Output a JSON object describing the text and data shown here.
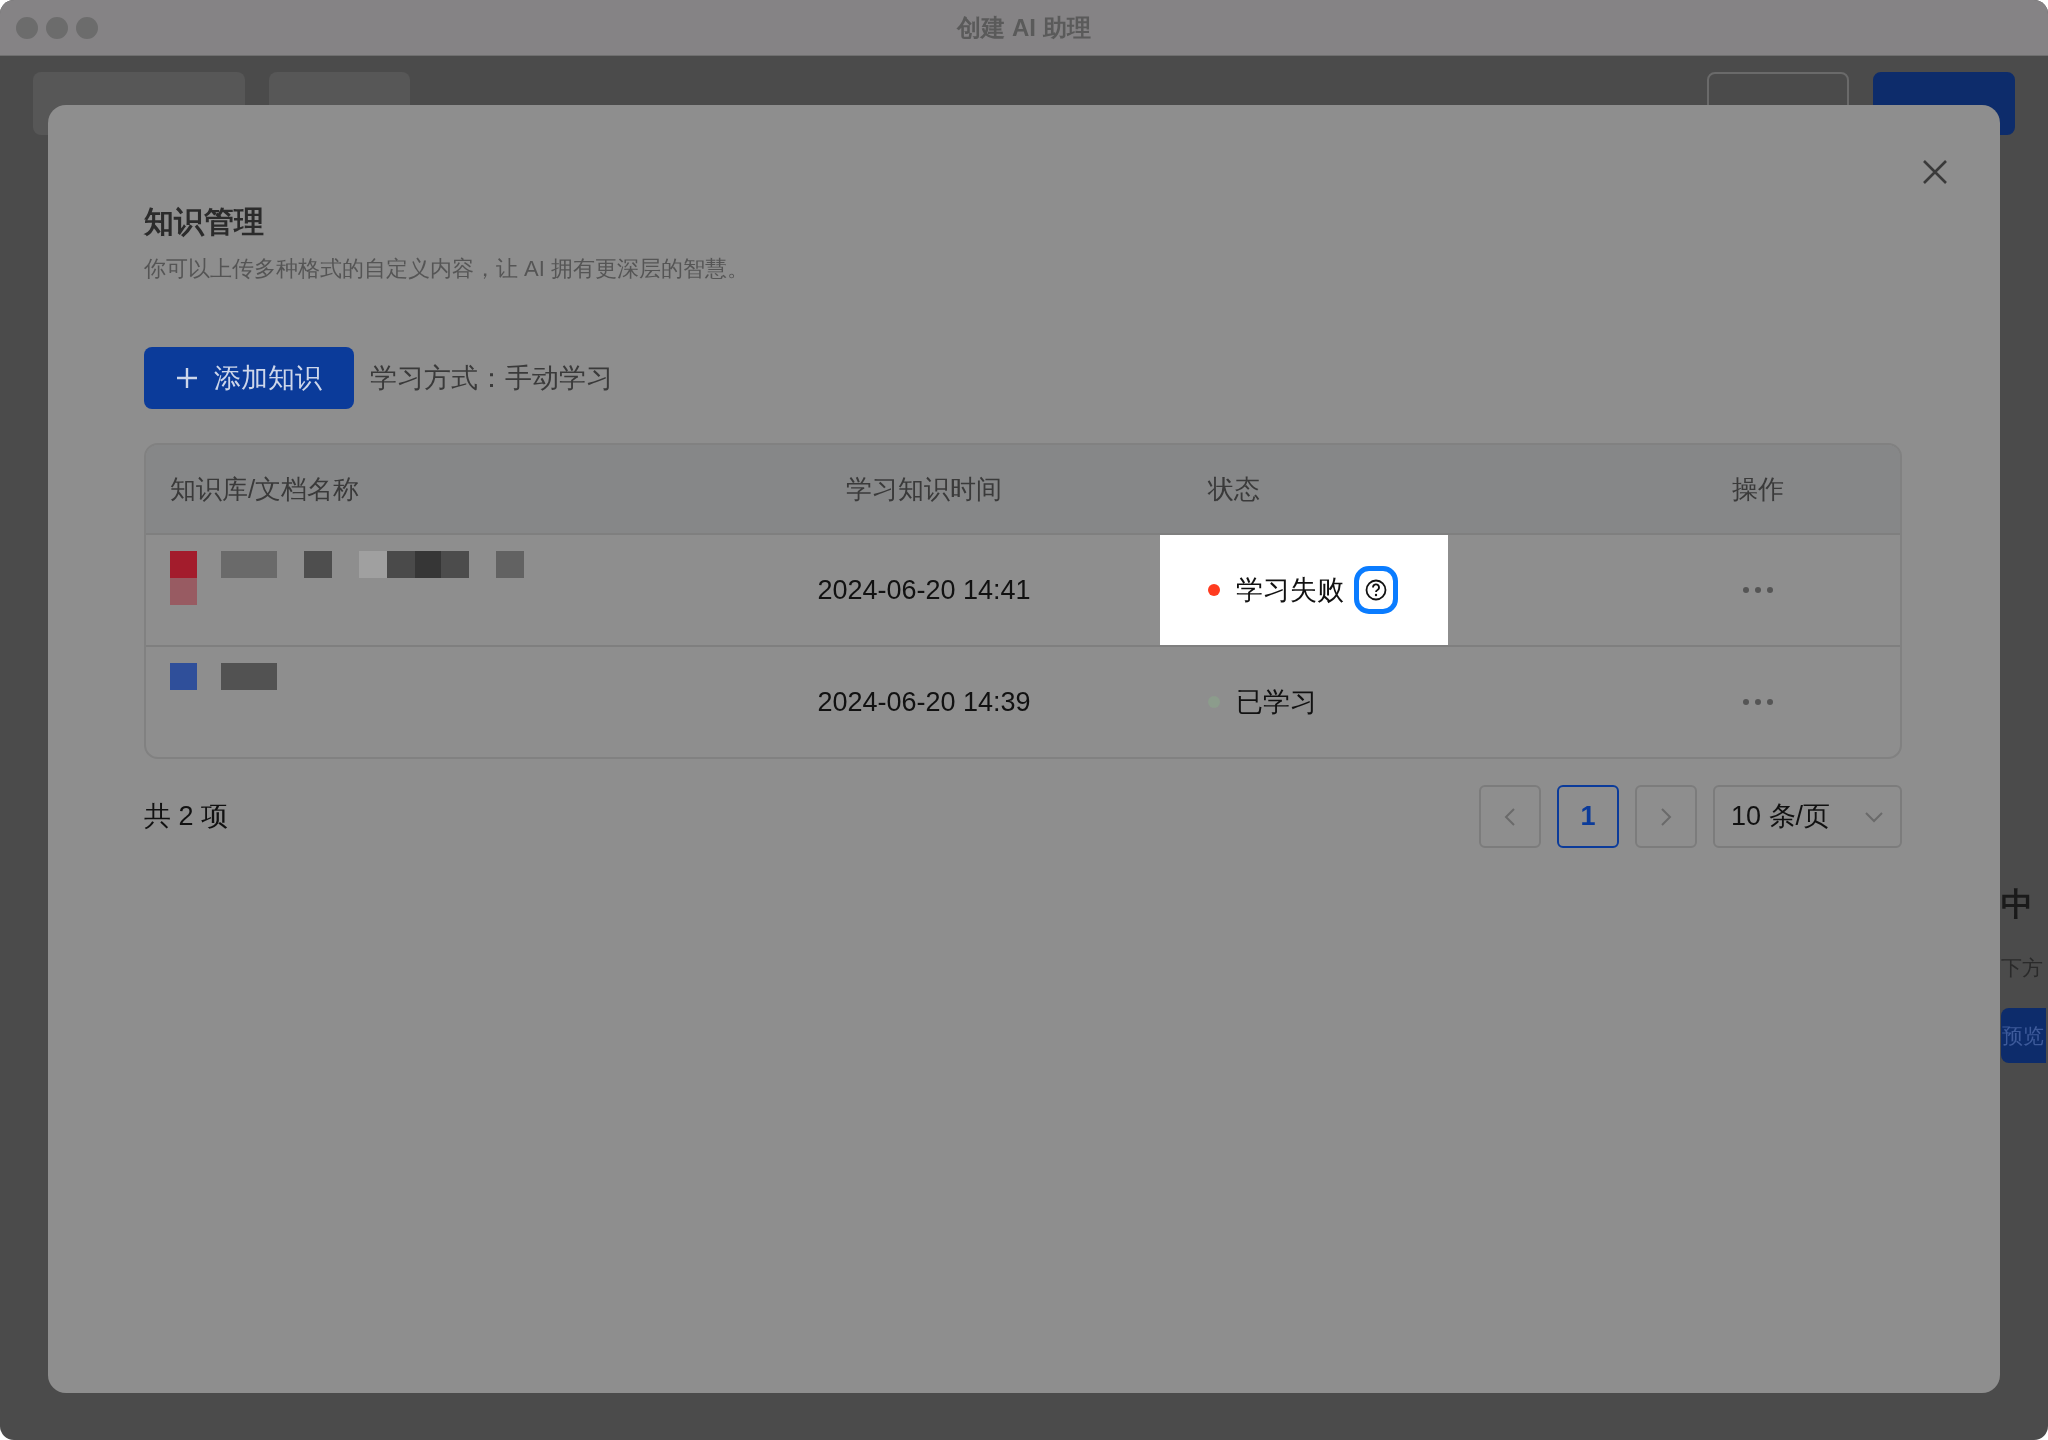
{
  "window": {
    "title": "创建 AI 助理"
  },
  "background": {
    "toolbar_left": [
      {
        "kind": "ai"
      },
      {
        "kind": "template"
      }
    ],
    "buttons": [
      {
        "kind": "outline"
      },
      {
        "kind": "primary"
      }
    ],
    "side_texts": [
      {
        "text": "中",
        "kind": "heading"
      },
      {
        "text": "下方",
        "kind": "text"
      },
      {
        "text": "预览",
        "kind": "button"
      }
    ]
  },
  "dialog": {
    "title": "知识管理",
    "subtitle": "你可以上传多种格式的自定义内容，让 AI 拥有更深层的智慧。",
    "add_button": "添加知识",
    "learn_mode": "学习方式：手动学习",
    "table": {
      "columns": [
        "知识库/文档名称",
        "学习知识时间",
        "状态",
        "操作"
      ],
      "rows": [
        {
          "file_icon": {
            "color": "#a31c2c"
          },
          "time": "2024-06-20 14:41",
          "status": {
            "text": "学习失败",
            "color": "#ff3b1f"
          },
          "help": true,
          "highlighted": true
        },
        {
          "file_icon": {
            "color": "#2f4f9a"
          },
          "time": "2024-06-20 14:39",
          "status": {
            "text": "已学习",
            "color": "#8c9c8c"
          },
          "help": false,
          "highlighted": false
        }
      ]
    },
    "total": "共 2 项",
    "pagination": {
      "pages": [
        {
          "label": "1",
          "selected": true
        }
      ],
      "page_size": "10 条/页"
    }
  }
}
